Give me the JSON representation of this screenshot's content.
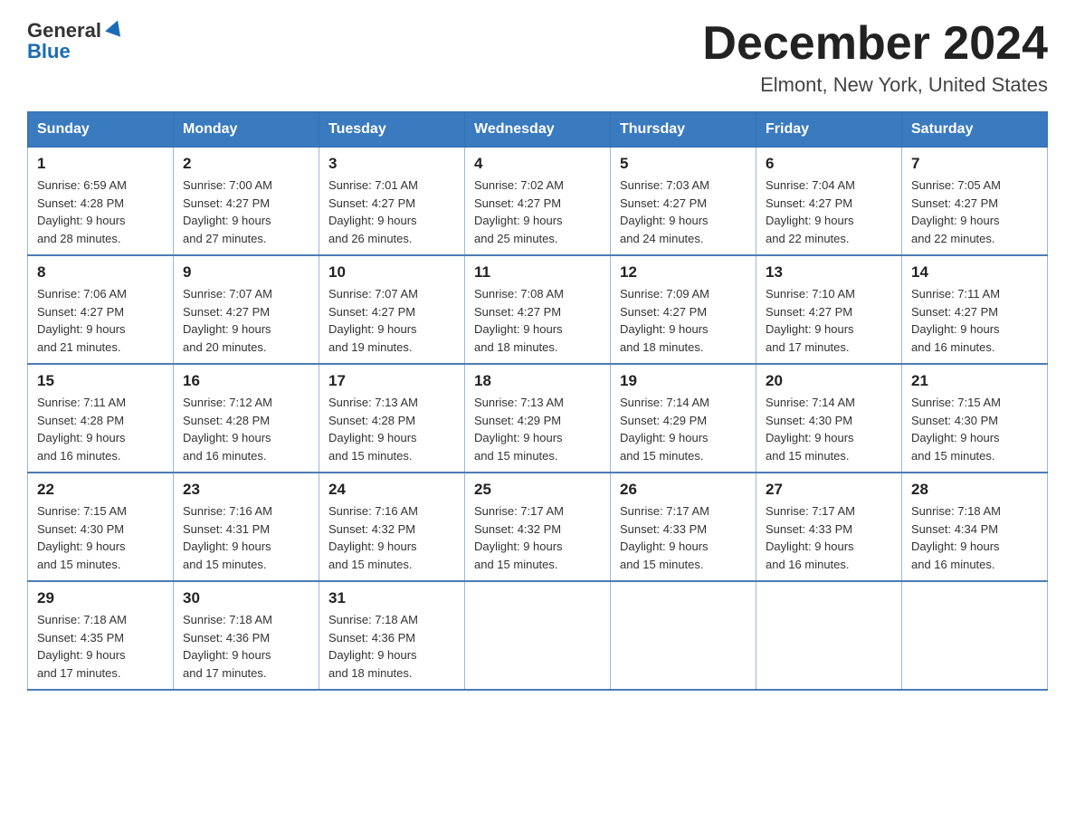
{
  "header": {
    "logo_line1": "General",
    "logo_line2": "Blue",
    "title": "December 2024",
    "subtitle": "Elmont, New York, United States"
  },
  "weekdays": [
    "Sunday",
    "Monday",
    "Tuesday",
    "Wednesday",
    "Thursday",
    "Friday",
    "Saturday"
  ],
  "weeks": [
    [
      {
        "day": "1",
        "sunrise": "6:59 AM",
        "sunset": "4:28 PM",
        "daylight": "9 hours and 28 minutes."
      },
      {
        "day": "2",
        "sunrise": "7:00 AM",
        "sunset": "4:27 PM",
        "daylight": "9 hours and 27 minutes."
      },
      {
        "day": "3",
        "sunrise": "7:01 AM",
        "sunset": "4:27 PM",
        "daylight": "9 hours and 26 minutes."
      },
      {
        "day": "4",
        "sunrise": "7:02 AM",
        "sunset": "4:27 PM",
        "daylight": "9 hours and 25 minutes."
      },
      {
        "day": "5",
        "sunrise": "7:03 AM",
        "sunset": "4:27 PM",
        "daylight": "9 hours and 24 minutes."
      },
      {
        "day": "6",
        "sunrise": "7:04 AM",
        "sunset": "4:27 PM",
        "daylight": "9 hours and 22 minutes."
      },
      {
        "day": "7",
        "sunrise": "7:05 AM",
        "sunset": "4:27 PM",
        "daylight": "9 hours and 22 minutes."
      }
    ],
    [
      {
        "day": "8",
        "sunrise": "7:06 AM",
        "sunset": "4:27 PM",
        "daylight": "9 hours and 21 minutes."
      },
      {
        "day": "9",
        "sunrise": "7:07 AM",
        "sunset": "4:27 PM",
        "daylight": "9 hours and 20 minutes."
      },
      {
        "day": "10",
        "sunrise": "7:07 AM",
        "sunset": "4:27 PM",
        "daylight": "9 hours and 19 minutes."
      },
      {
        "day": "11",
        "sunrise": "7:08 AM",
        "sunset": "4:27 PM",
        "daylight": "9 hours and 18 minutes."
      },
      {
        "day": "12",
        "sunrise": "7:09 AM",
        "sunset": "4:27 PM",
        "daylight": "9 hours and 18 minutes."
      },
      {
        "day": "13",
        "sunrise": "7:10 AM",
        "sunset": "4:27 PM",
        "daylight": "9 hours and 17 minutes."
      },
      {
        "day": "14",
        "sunrise": "7:11 AM",
        "sunset": "4:27 PM",
        "daylight": "9 hours and 16 minutes."
      }
    ],
    [
      {
        "day": "15",
        "sunrise": "7:11 AM",
        "sunset": "4:28 PM",
        "daylight": "9 hours and 16 minutes."
      },
      {
        "day": "16",
        "sunrise": "7:12 AM",
        "sunset": "4:28 PM",
        "daylight": "9 hours and 16 minutes."
      },
      {
        "day": "17",
        "sunrise": "7:13 AM",
        "sunset": "4:28 PM",
        "daylight": "9 hours and 15 minutes."
      },
      {
        "day": "18",
        "sunrise": "7:13 AM",
        "sunset": "4:29 PM",
        "daylight": "9 hours and 15 minutes."
      },
      {
        "day": "19",
        "sunrise": "7:14 AM",
        "sunset": "4:29 PM",
        "daylight": "9 hours and 15 minutes."
      },
      {
        "day": "20",
        "sunrise": "7:14 AM",
        "sunset": "4:30 PM",
        "daylight": "9 hours and 15 minutes."
      },
      {
        "day": "21",
        "sunrise": "7:15 AM",
        "sunset": "4:30 PM",
        "daylight": "9 hours and 15 minutes."
      }
    ],
    [
      {
        "day": "22",
        "sunrise": "7:15 AM",
        "sunset": "4:30 PM",
        "daylight": "9 hours and 15 minutes."
      },
      {
        "day": "23",
        "sunrise": "7:16 AM",
        "sunset": "4:31 PM",
        "daylight": "9 hours and 15 minutes."
      },
      {
        "day": "24",
        "sunrise": "7:16 AM",
        "sunset": "4:32 PM",
        "daylight": "9 hours and 15 minutes."
      },
      {
        "day": "25",
        "sunrise": "7:17 AM",
        "sunset": "4:32 PM",
        "daylight": "9 hours and 15 minutes."
      },
      {
        "day": "26",
        "sunrise": "7:17 AM",
        "sunset": "4:33 PM",
        "daylight": "9 hours and 15 minutes."
      },
      {
        "day": "27",
        "sunrise": "7:17 AM",
        "sunset": "4:33 PM",
        "daylight": "9 hours and 16 minutes."
      },
      {
        "day": "28",
        "sunrise": "7:18 AM",
        "sunset": "4:34 PM",
        "daylight": "9 hours and 16 minutes."
      }
    ],
    [
      {
        "day": "29",
        "sunrise": "7:18 AM",
        "sunset": "4:35 PM",
        "daylight": "9 hours and 17 minutes."
      },
      {
        "day": "30",
        "sunrise": "7:18 AM",
        "sunset": "4:36 PM",
        "daylight": "9 hours and 17 minutes."
      },
      {
        "day": "31",
        "sunrise": "7:18 AM",
        "sunset": "4:36 PM",
        "daylight": "9 hours and 18 minutes."
      },
      null,
      null,
      null,
      null
    ]
  ],
  "labels": {
    "sunrise": "Sunrise:",
    "sunset": "Sunset:",
    "daylight": "Daylight:"
  }
}
